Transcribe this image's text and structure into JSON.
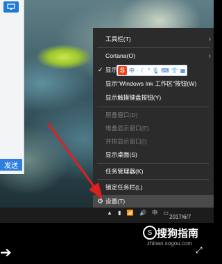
{
  "chat_window": {
    "send_label": "发送"
  },
  "context_menu": {
    "items": [
      {
        "label": "工具栏(T)",
        "submenu": true
      },
      {
        "label": "Cortana(O)",
        "submenu": true
      },
      {
        "label": "显示\"任务视图\"按钮(V)",
        "checked": true
      },
      {
        "label": "显示\"Windows Ink 工作区\"按钮(W)"
      },
      {
        "label": "显示触摸键盘按钮(Y)"
      },
      {
        "label": "层叠窗口(D)",
        "disabled": true
      },
      {
        "label": "堆叠显示窗口(E)",
        "disabled": true
      },
      {
        "label": "并排显示窗口(I)",
        "disabled": true
      },
      {
        "label": "显示桌面(S)"
      },
      {
        "label": "任务管理器(K)"
      },
      {
        "label": "锁定任务栏(L)"
      },
      {
        "label": "设置(T)",
        "highlighted": true
      }
    ]
  },
  "ime_toolbar": {
    "logo": "S",
    "items": [
      "中",
      "·",
      "°",
      "⌨"
    ]
  },
  "taskbar": {
    "date": "2017/6/7"
  },
  "watermark": {
    "brand": "搜狗指南",
    "url": "zhinan.sogou.com"
  },
  "colors": {
    "menu_bg": "#2b2b2b",
    "highlight_bg": "#4a4a4a",
    "send_button": "#2e7fe0",
    "arrow_red": "#e02020"
  }
}
